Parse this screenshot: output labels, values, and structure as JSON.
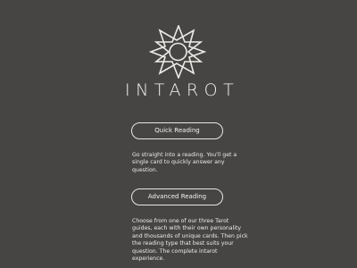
{
  "app": {
    "brand_name": "INTAROT",
    "logo_icon": "star-mandala-icon"
  },
  "menu": {
    "quick_reading": {
      "button_label": "Quick Reading",
      "description": "Go straight into a reading. You'll get a single card to quickly answer any question."
    },
    "advanced_reading": {
      "button_label": "Advanced Reading",
      "description": "Choose from one of our three Tarot guides, each with their own personality and thousands of unique cards. Then pick the reading type that best suits your question. The complete intarot experience."
    }
  },
  "colors": {
    "background": "#474543",
    "foreground": "#efeeec"
  }
}
